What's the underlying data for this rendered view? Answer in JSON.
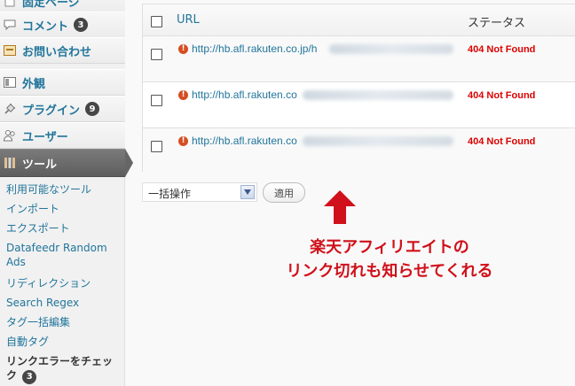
{
  "sidebar": {
    "top_cut_label": "固定ページ",
    "comments": {
      "label": "コメント",
      "count": "3"
    },
    "contact": {
      "label": "お問い合わせ"
    },
    "appearance": {
      "label": "外観"
    },
    "plugins": {
      "label": "プラグイン",
      "count": "9"
    },
    "users": {
      "label": "ユーザー"
    },
    "tools": {
      "label": "ツール"
    },
    "submenu": [
      {
        "label": "利用可能なツール"
      },
      {
        "label": "インポート"
      },
      {
        "label": "エクスポート"
      },
      {
        "label": "Datafeedr Random Ads"
      },
      {
        "label": "リディレクション"
      },
      {
        "label": "Search Regex"
      },
      {
        "label": "タグ一括編集"
      },
      {
        "label": "自動タグ"
      },
      {
        "label": "リンクエラーをチェック",
        "count": "3"
      }
    ]
  },
  "table": {
    "col_url": "URL",
    "col_status": "ステータス",
    "rows": [
      {
        "url": "http://hb.afl.rakuten.co.jp/h",
        "status": "404 Not Found"
      },
      {
        "url": "http://hb.afl.rakuten.co",
        "status": "404 Not Found"
      },
      {
        "url": "http://hb.afl.rakuten.co",
        "status": "404 Not Found"
      }
    ]
  },
  "bulk": {
    "select_value": "一括操作",
    "apply_label": "適用"
  },
  "annotation": {
    "line1": "楽天アフィリエイトの",
    "line2": "リンク切れも知らせてくれる"
  },
  "colors": {
    "link": "#21759b",
    "error": "#dd0000",
    "annotation": "#d0101a"
  }
}
